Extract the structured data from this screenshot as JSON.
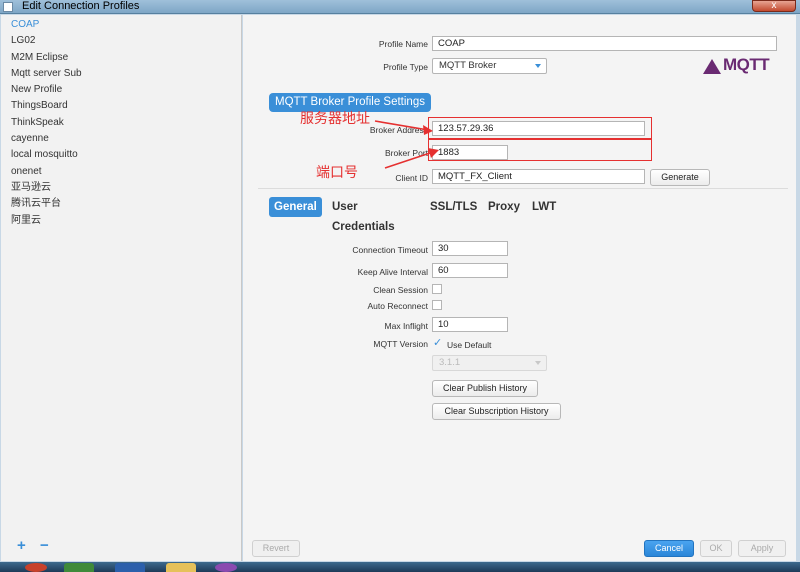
{
  "window": {
    "title": "Edit Connection Profiles",
    "close_label": "x"
  },
  "sidebar": {
    "profiles": [
      {
        "label": "COAP",
        "selected": true
      },
      {
        "label": "LG02"
      },
      {
        "label": "M2M Eclipse"
      },
      {
        "label": "Mqtt server Sub"
      },
      {
        "label": "New Profile"
      },
      {
        "label": "ThingsBoard"
      },
      {
        "label": "ThinkSpeak"
      },
      {
        "label": "cayenne"
      },
      {
        "label": "local mosquitto"
      },
      {
        "label": "onenet"
      },
      {
        "label": "亚马逊云"
      },
      {
        "label": "腾讯云平台"
      },
      {
        "label": "阿里云"
      }
    ],
    "add_label": "+",
    "remove_label": "−"
  },
  "profile": {
    "name_label": "Profile Name",
    "name_value": "COAP",
    "type_label": "Profile Type",
    "type_value": "MQTT Broker",
    "logo_text": "MQTT"
  },
  "broker_section": {
    "header": "MQTT Broker Profile Settings",
    "address_label": "Broker Address",
    "address_value": "123.57.29.36",
    "port_label": "Broker Port",
    "port_value": "1883",
    "client_id_label": "Client ID",
    "client_id_value": "MQTT_FX_Client",
    "generate_label": "Generate"
  },
  "annotations": {
    "server_address": "服务器地址",
    "port": "端口号",
    "color": "#e53030"
  },
  "tabs": [
    {
      "label": "General",
      "active": true
    },
    {
      "label": "User Credentials"
    },
    {
      "label": "SSL/TLS"
    },
    {
      "label": "Proxy"
    },
    {
      "label": "LWT"
    }
  ],
  "general": {
    "connection_timeout_label": "Connection Timeout",
    "connection_timeout_value": "30",
    "keep_alive_label": "Keep Alive Interval",
    "keep_alive_value": "60",
    "clean_session_label": "Clean Session",
    "clean_session_checked": false,
    "auto_reconnect_label": "Auto Reconnect",
    "auto_reconnect_checked": false,
    "max_inflight_label": "Max Inflight",
    "max_inflight_value": "10",
    "mqtt_version_label": "MQTT Version",
    "use_default_label": "Use Default",
    "use_default_checked": true,
    "version_value": "3.1.1",
    "clear_publish_label": "Clear Publish History",
    "clear_subscription_label": "Clear Subscription History"
  },
  "footer": {
    "revert_label": "Revert",
    "cancel_label": "Cancel",
    "ok_label": "OK",
    "apply_label": "Apply"
  },
  "colors": {
    "accent": "#3a8fd8",
    "logo": "#6a2a72"
  }
}
